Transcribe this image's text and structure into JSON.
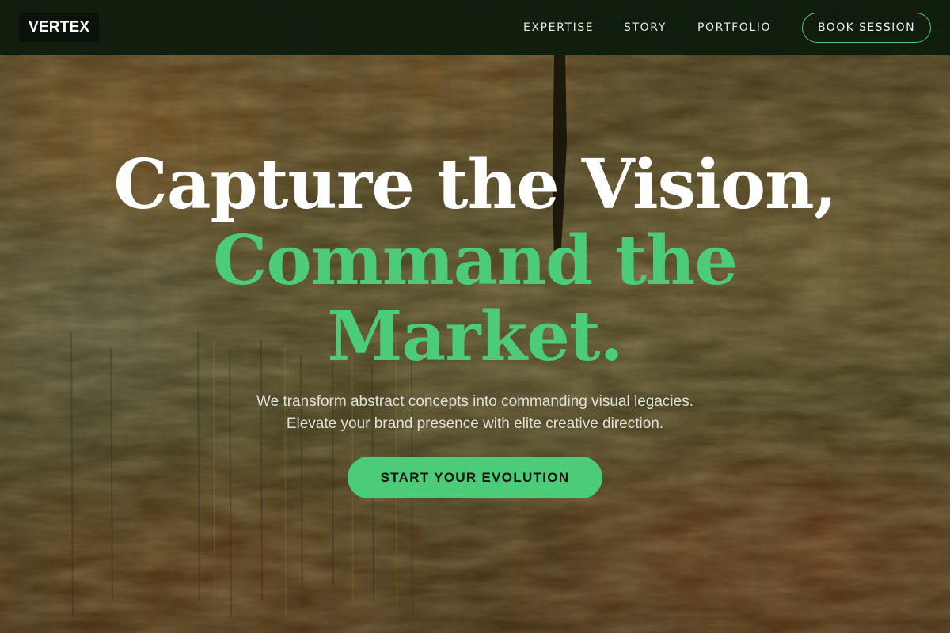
{
  "brand": {
    "logo_text": "VERTEX"
  },
  "nav": {
    "links": [
      {
        "label": "EXPERTISE"
      },
      {
        "label": "STORY"
      },
      {
        "label": "PORTFOLIO"
      }
    ],
    "cta_label": "BOOK SESSION"
  },
  "hero": {
    "headline_line_1": "Capture the Vision,",
    "headline_line_2": "Command the",
    "headline_line_3": "Market.",
    "subtext_line_1": "We transform abstract concepts into commanding visual legacies.",
    "subtext_line_2": "Elevate your brand presence with elite creative direction.",
    "cta_label": "START YOUR EVOLUTION"
  },
  "colors": {
    "accent": "#4ccb79",
    "navbar_bg": "#0d1b0d",
    "headline_white": "#ffffff",
    "cta_text": "#0d160d"
  }
}
